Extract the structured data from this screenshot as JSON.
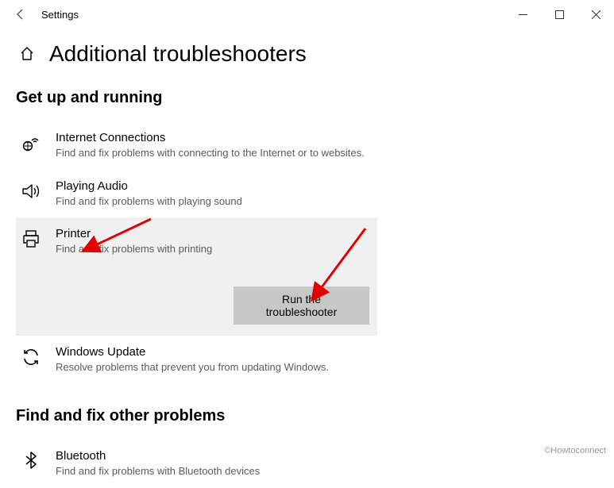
{
  "window": {
    "app_title": "Settings"
  },
  "header": {
    "page_title": "Additional troubleshooters"
  },
  "sections": {
    "get_up_running": "Get up and running",
    "find_fix_other": "Find and fix other problems"
  },
  "troubleshooters": {
    "internet": {
      "title": "Internet Connections",
      "desc": "Find and fix problems with connecting to the Internet or to websites."
    },
    "audio": {
      "title": "Playing Audio",
      "desc": "Find and fix problems with playing sound"
    },
    "printer": {
      "title": "Printer",
      "desc": "Find and fix problems with printing",
      "run_button": "Run the troubleshooter"
    },
    "windows_update": {
      "title": "Windows Update",
      "desc": "Resolve problems that prevent you from updating Windows."
    },
    "bluetooth": {
      "title": "Bluetooth",
      "desc": "Find and fix problems with Bluetooth devices"
    }
  },
  "watermark": "©Howtoconnect"
}
